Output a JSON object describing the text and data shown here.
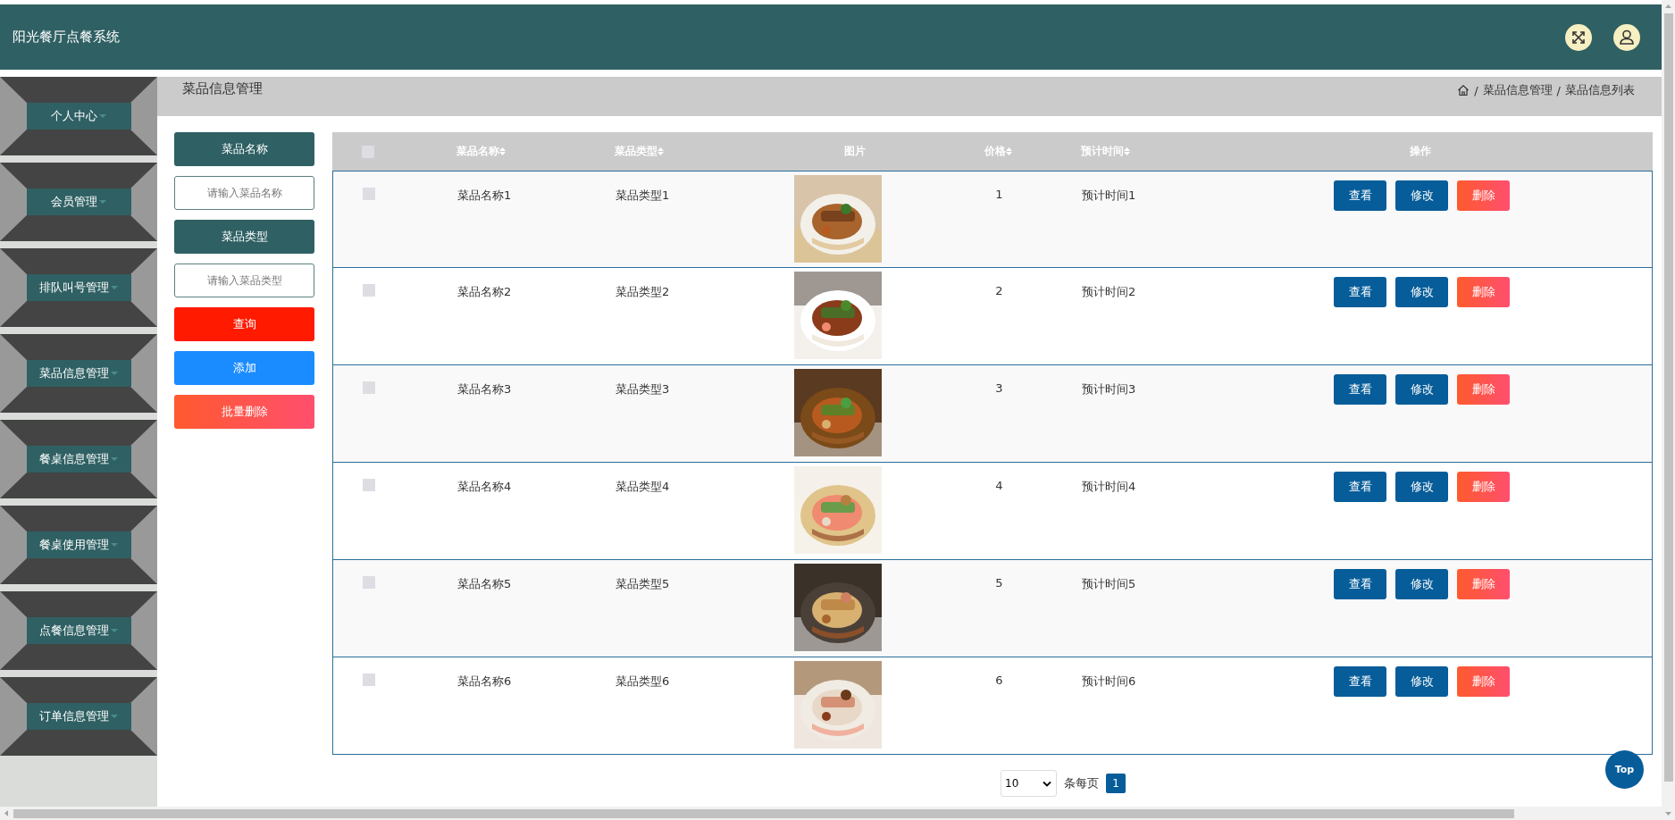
{
  "header": {
    "title": "阳光餐厅点餐系统"
  },
  "sidebar": {
    "items": [
      {
        "label": "个人中心"
      },
      {
        "label": "会员管理"
      },
      {
        "label": "排队叫号管理"
      },
      {
        "label": "菜品信息管理"
      },
      {
        "label": "餐桌信息管理"
      },
      {
        "label": "餐桌使用管理"
      },
      {
        "label": "点餐信息管理"
      },
      {
        "label": "订单信息管理"
      }
    ]
  },
  "page_heading": {
    "title": "菜品信息管理",
    "breadcrumb": {
      "separator": "/",
      "items": [
        "菜品信息管理",
        "菜品信息列表"
      ]
    }
  },
  "filters": {
    "fields": [
      {
        "label": "菜品名称",
        "placeholder": "请输入菜品名称"
      },
      {
        "label": "菜品类型",
        "placeholder": "请输入菜品类型"
      }
    ],
    "buttons": [
      {
        "kind": "search",
        "label": "查询"
      },
      {
        "kind": "add",
        "label": "添加"
      },
      {
        "kind": "batch-delete",
        "label": "批量删除"
      }
    ]
  },
  "table": {
    "select_all": {
      "checked": false
    },
    "columns": [
      {
        "label": "菜品名称",
        "sortable": true
      },
      {
        "label": "菜品类型",
        "sortable": true
      },
      {
        "label": "图片",
        "sortable": false
      },
      {
        "label": "价格",
        "sortable": true
      },
      {
        "label": "预计时间",
        "sortable": true
      },
      {
        "label": "操作",
        "sortable": false
      }
    ],
    "rows": [
      {
        "checked": false,
        "name": "菜品名称1",
        "type": "菜品类型1",
        "price": "1",
        "time": "预计时间1",
        "actions": [
          "查看",
          "修改",
          "删除"
        ]
      },
      {
        "checked": false,
        "name": "菜品名称2",
        "type": "菜品类型2",
        "price": "2",
        "time": "预计时间2",
        "actions": [
          "查看",
          "修改",
          "删除"
        ]
      },
      {
        "checked": false,
        "name": "菜品名称3",
        "type": "菜品类型3",
        "price": "3",
        "time": "预计时间3",
        "actions": [
          "查看",
          "修改",
          "删除"
        ]
      },
      {
        "checked": false,
        "name": "菜品名称4",
        "type": "菜品类型4",
        "price": "4",
        "time": "预计时间4",
        "actions": [
          "查看",
          "修改",
          "删除"
        ]
      },
      {
        "checked": false,
        "name": "菜品名称5",
        "type": "菜品类型5",
        "price": "5",
        "time": "预计时间5",
        "actions": [
          "查看",
          "修改",
          "删除"
        ]
      },
      {
        "checked": false,
        "name": "菜品名称6",
        "type": "菜品类型6",
        "price": "6",
        "time": "预计时间6",
        "actions": [
          "查看",
          "修改",
          "删除"
        ]
      }
    ]
  },
  "pagination": {
    "page_size": "10",
    "page_size_label": "条每页",
    "pages": [
      {
        "label": "1",
        "selected": true
      }
    ]
  },
  "back_to_top": {
    "label": "Top"
  }
}
